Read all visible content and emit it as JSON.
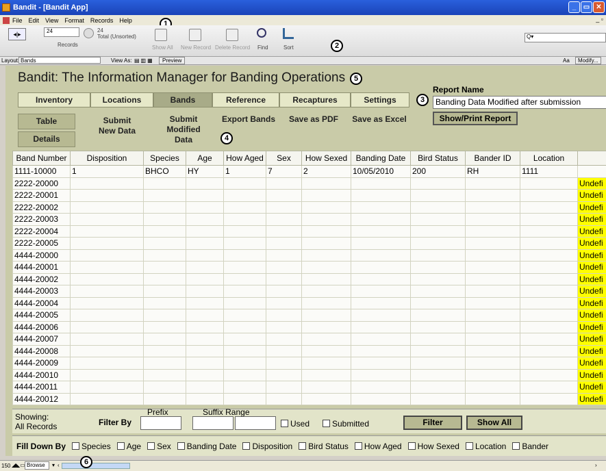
{
  "window": {
    "title": "Bandit - [Bandit App]"
  },
  "menu": [
    "File",
    "Edit",
    "View",
    "Format",
    "Records",
    "Help"
  ],
  "toolbar": {
    "record_value": "24",
    "records_label": "Records",
    "total_count": "24",
    "total_label": "Total (Unsorted)",
    "show_all": "Show All",
    "new_record": "New Record",
    "delete_record": "Delete Record",
    "find": "Find",
    "sort": "Sort",
    "search_placeholder": "Q▾"
  },
  "layoutbar": {
    "layout_label": "Layout:",
    "layout_value": "Bands",
    "view_as": "View As:",
    "preview": "Preview",
    "aa": "Aa",
    "modify": "Modify..."
  },
  "app": {
    "title": "Bandit: The Information Manager for Banding Operations",
    "tabs": [
      "Inventory",
      "Locations",
      "Bands",
      "Reference",
      "Recaptures",
      "Settings"
    ],
    "sub": {
      "table": "Table",
      "details": "Details",
      "submit_new": "Submit New Data",
      "submit_modified": "Submit Modified Data",
      "export_bands": "Export Bands",
      "save_pdf": "Save as PDF",
      "save_excel": "Save as Excel"
    },
    "report": {
      "label": "Report Name",
      "value": "Banding Data Modified after submission",
      "button": "Show/Print Report"
    }
  },
  "callouts": [
    "1",
    "2",
    "3",
    "4",
    "5",
    "6"
  ],
  "grid": {
    "columns": [
      "Band Number",
      "Disposition",
      "Species",
      "Age",
      "How Aged",
      "Sex",
      "How Sexed",
      "Banding Date",
      "Bird Status",
      "Bander ID",
      "Location",
      ""
    ],
    "first_row": [
      "1111-10000",
      "1",
      "BHCO",
      "HY",
      "1",
      "7",
      "2",
      "10/05/2010",
      "200",
      "RH",
      "1111",
      ""
    ],
    "band_numbers": [
      "2222-20000",
      "2222-20001",
      "2222-20002",
      "2222-20003",
      "2222-20004",
      "2222-20005",
      "4444-20000",
      "4444-20001",
      "4444-20002",
      "4444-20003",
      "4444-20004",
      "4444-20005",
      "4444-20006",
      "4444-20007",
      "4444-20008",
      "4444-20009",
      "4444-20010",
      "4444-20011",
      "4444-20012"
    ],
    "status_text": "Undefi"
  },
  "filter": {
    "showing": "Showing:",
    "all_records": "All Records",
    "filter_by": "Filter By",
    "prefix": "Prefix",
    "suffix_range": "Suffix Range",
    "used": "Used",
    "submitted": "Submitted",
    "filter_btn": "Filter",
    "show_all_btn": "Show All"
  },
  "filldown": {
    "label": "Fill Down By",
    "options": [
      "Species",
      "Age",
      "Sex",
      "Banding Date",
      "Disposition",
      "Bird Status",
      "How Aged",
      "How Sexed",
      "Location",
      "Bander"
    ]
  },
  "statusbar": {
    "zoom": "150",
    "mode": "Browse"
  }
}
